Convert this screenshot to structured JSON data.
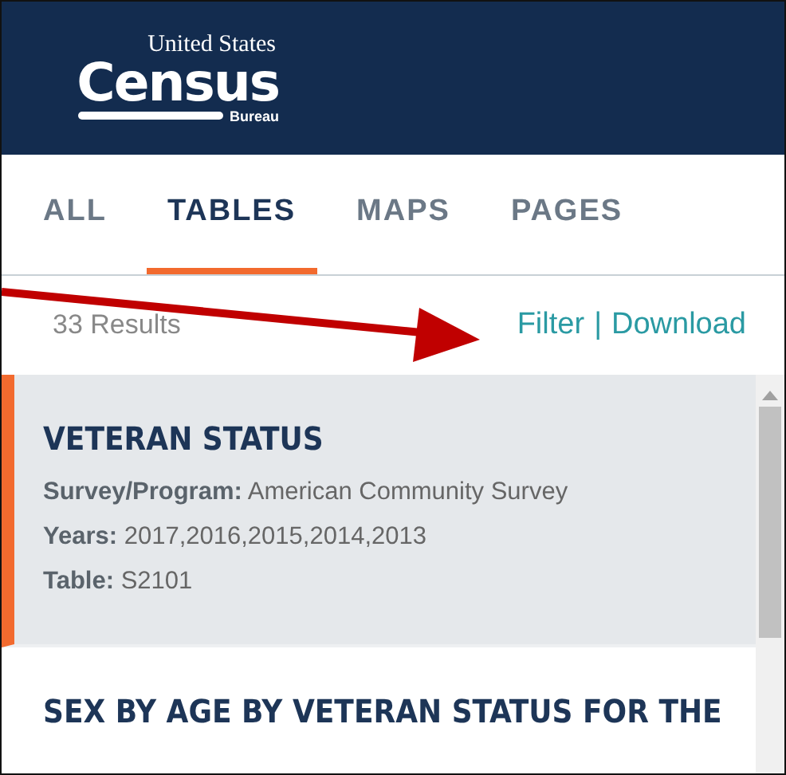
{
  "logo": {
    "top": "United States",
    "name": "Census",
    "sub": "Bureau"
  },
  "tabs": [
    {
      "label": "ALL",
      "selected": false
    },
    {
      "label": "TABLES",
      "selected": true
    },
    {
      "label": "MAPS",
      "selected": false
    },
    {
      "label": "PAGES",
      "selected": false
    }
  ],
  "results_count": "33 Results",
  "actions": {
    "filter": "Filter",
    "separator": "|",
    "download": "Download"
  },
  "results": [
    {
      "title": "VETERAN STATUS",
      "selected": true,
      "fields": [
        {
          "label": "Survey/Program:",
          "value": "American Community Survey"
        },
        {
          "label": "Years:",
          "value": "2017,2016,2015,2014,2013"
        },
        {
          "label": "Table:",
          "value": "S2101"
        }
      ]
    },
    {
      "title": "SEX BY AGE BY VETERAN STATUS FOR THE",
      "selected": false
    }
  ]
}
